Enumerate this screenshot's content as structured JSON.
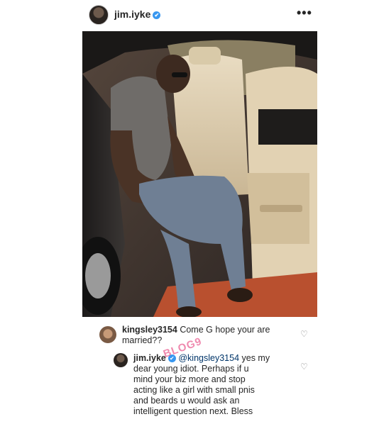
{
  "post": {
    "username": "jim.iyke",
    "verified_mark": "✔",
    "more_icon": "•••",
    "icons": {
      "verified": "verified-badge-icon",
      "more": "more-options-icon",
      "heart": "heart-icon"
    },
    "colors": {
      "verified": "#3897f0",
      "mention": "#003569",
      "watermark": "#e32b6e"
    }
  },
  "comments": [
    {
      "username": "kingsley3154",
      "text_line1": "Come G hope your are",
      "text_line2": "married??"
    },
    {
      "username": "jim.iyke",
      "mention": "@kingsley3154",
      "text_line1": " yes my",
      "text_line2": "dear young idiot. Perhaps if u",
      "text_line3": "mind your biz more and stop",
      "text_line4": "acting like a girl with small p",
      "text_line4b": "nis",
      "text_line5": "and beards u would ask an",
      "text_line6": "intelligent question next. Bless"
    }
  ],
  "watermark_text": "BLOG9"
}
